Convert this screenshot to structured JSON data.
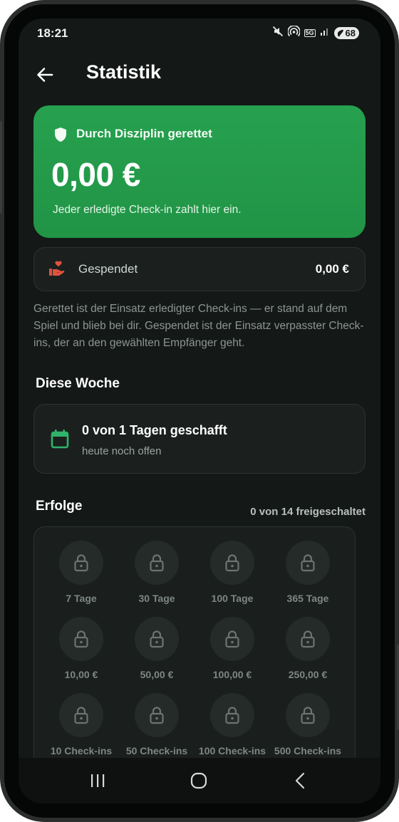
{
  "status_bar": {
    "time": "18:21",
    "network_badge": "5G",
    "battery": "68",
    "icons": [
      "mute-icon",
      "hotspot-icon",
      "signal-icon",
      "battery-icon"
    ]
  },
  "header": {
    "title": "Statistik",
    "back_icon": "arrow-left-icon"
  },
  "saved": {
    "label": "Durch Disziplin gerettet",
    "amount": "0,00 €",
    "subtitle": "Jeder erledigte Check-in zahlt hier ein.",
    "icon": "shield-icon",
    "color": "#26a14f"
  },
  "donated": {
    "label": "Gespendet",
    "value": "0,00 €",
    "icon": "donate-hand-icon",
    "icon_color": "#e0533f"
  },
  "explanation": "Gerettet ist der Einsatz erledigter Check-ins — er stand auf dem Spiel und blieb bei dir. Gespendet ist der Einsatz verpasster Check-ins, der an den gewählten Empfänger geht.",
  "week": {
    "section_title": "Diese Woche",
    "main": "0 von 1 Tagen geschafft",
    "sub": "heute noch offen",
    "icon": "calendar-icon",
    "icon_color": "#2fb36b"
  },
  "achievements": {
    "section_title": "Erfolge",
    "count_text": "0 von 14 freigeschaltet",
    "icon": "lock-icon",
    "items": [
      {
        "label": "7 Tage"
      },
      {
        "label": "30 Tage"
      },
      {
        "label": "100 Tage"
      },
      {
        "label": "365 Tage"
      },
      {
        "label": "10,00 €"
      },
      {
        "label": "50,00 €"
      },
      {
        "label": "100,00 €"
      },
      {
        "label": "250,00 €"
      },
      {
        "label": "10 Check-ins"
      },
      {
        "label": "50 Check-ins"
      },
      {
        "label": "100 Check-ins"
      },
      {
        "label": "500 Check-ins"
      }
    ]
  },
  "navbar": {
    "icons": [
      "recents-icon",
      "home-icon",
      "back-nav-icon"
    ]
  }
}
